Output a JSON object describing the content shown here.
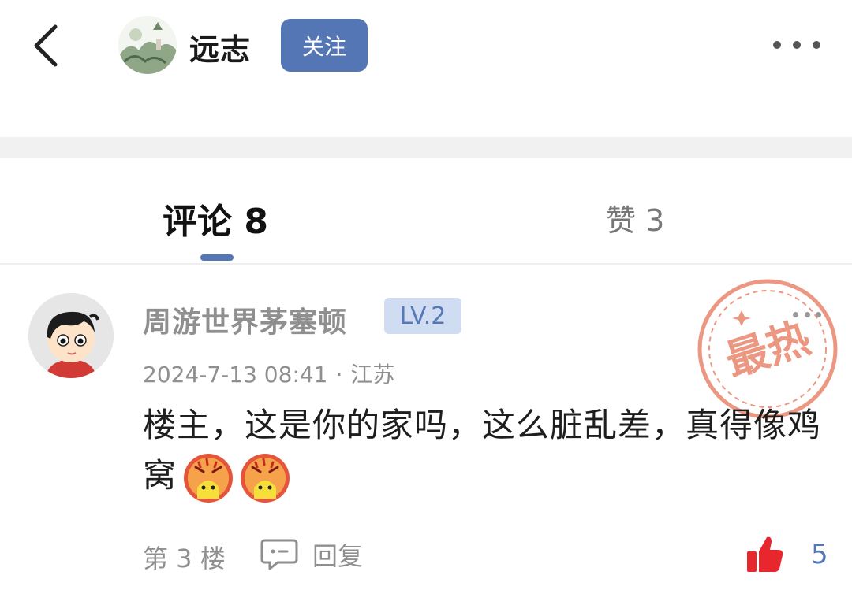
{
  "header": {
    "poster_name": "远志",
    "follow_label": "关注"
  },
  "tabs": {
    "comments_label": "评论 8",
    "likes_label": "赞 3"
  },
  "comment": {
    "username": "周游世界茅塞顿",
    "level": "LV.2",
    "date": "2024-7-13 08:41",
    "separator": "·",
    "location": "江苏",
    "text": "楼主，这是你的家吗，这么脏乱差，真得像鸡窝",
    "emojis": [
      "angry-pikachu-emoji",
      "angry-pikachu-emoji"
    ],
    "floor": "第 3 楼",
    "reply_label": "回复",
    "like_count": "5",
    "hot_badge_text": "最热"
  },
  "colors": {
    "accent": "#5576b5",
    "like_red": "#e8262e",
    "stamp": "#e9866c"
  }
}
